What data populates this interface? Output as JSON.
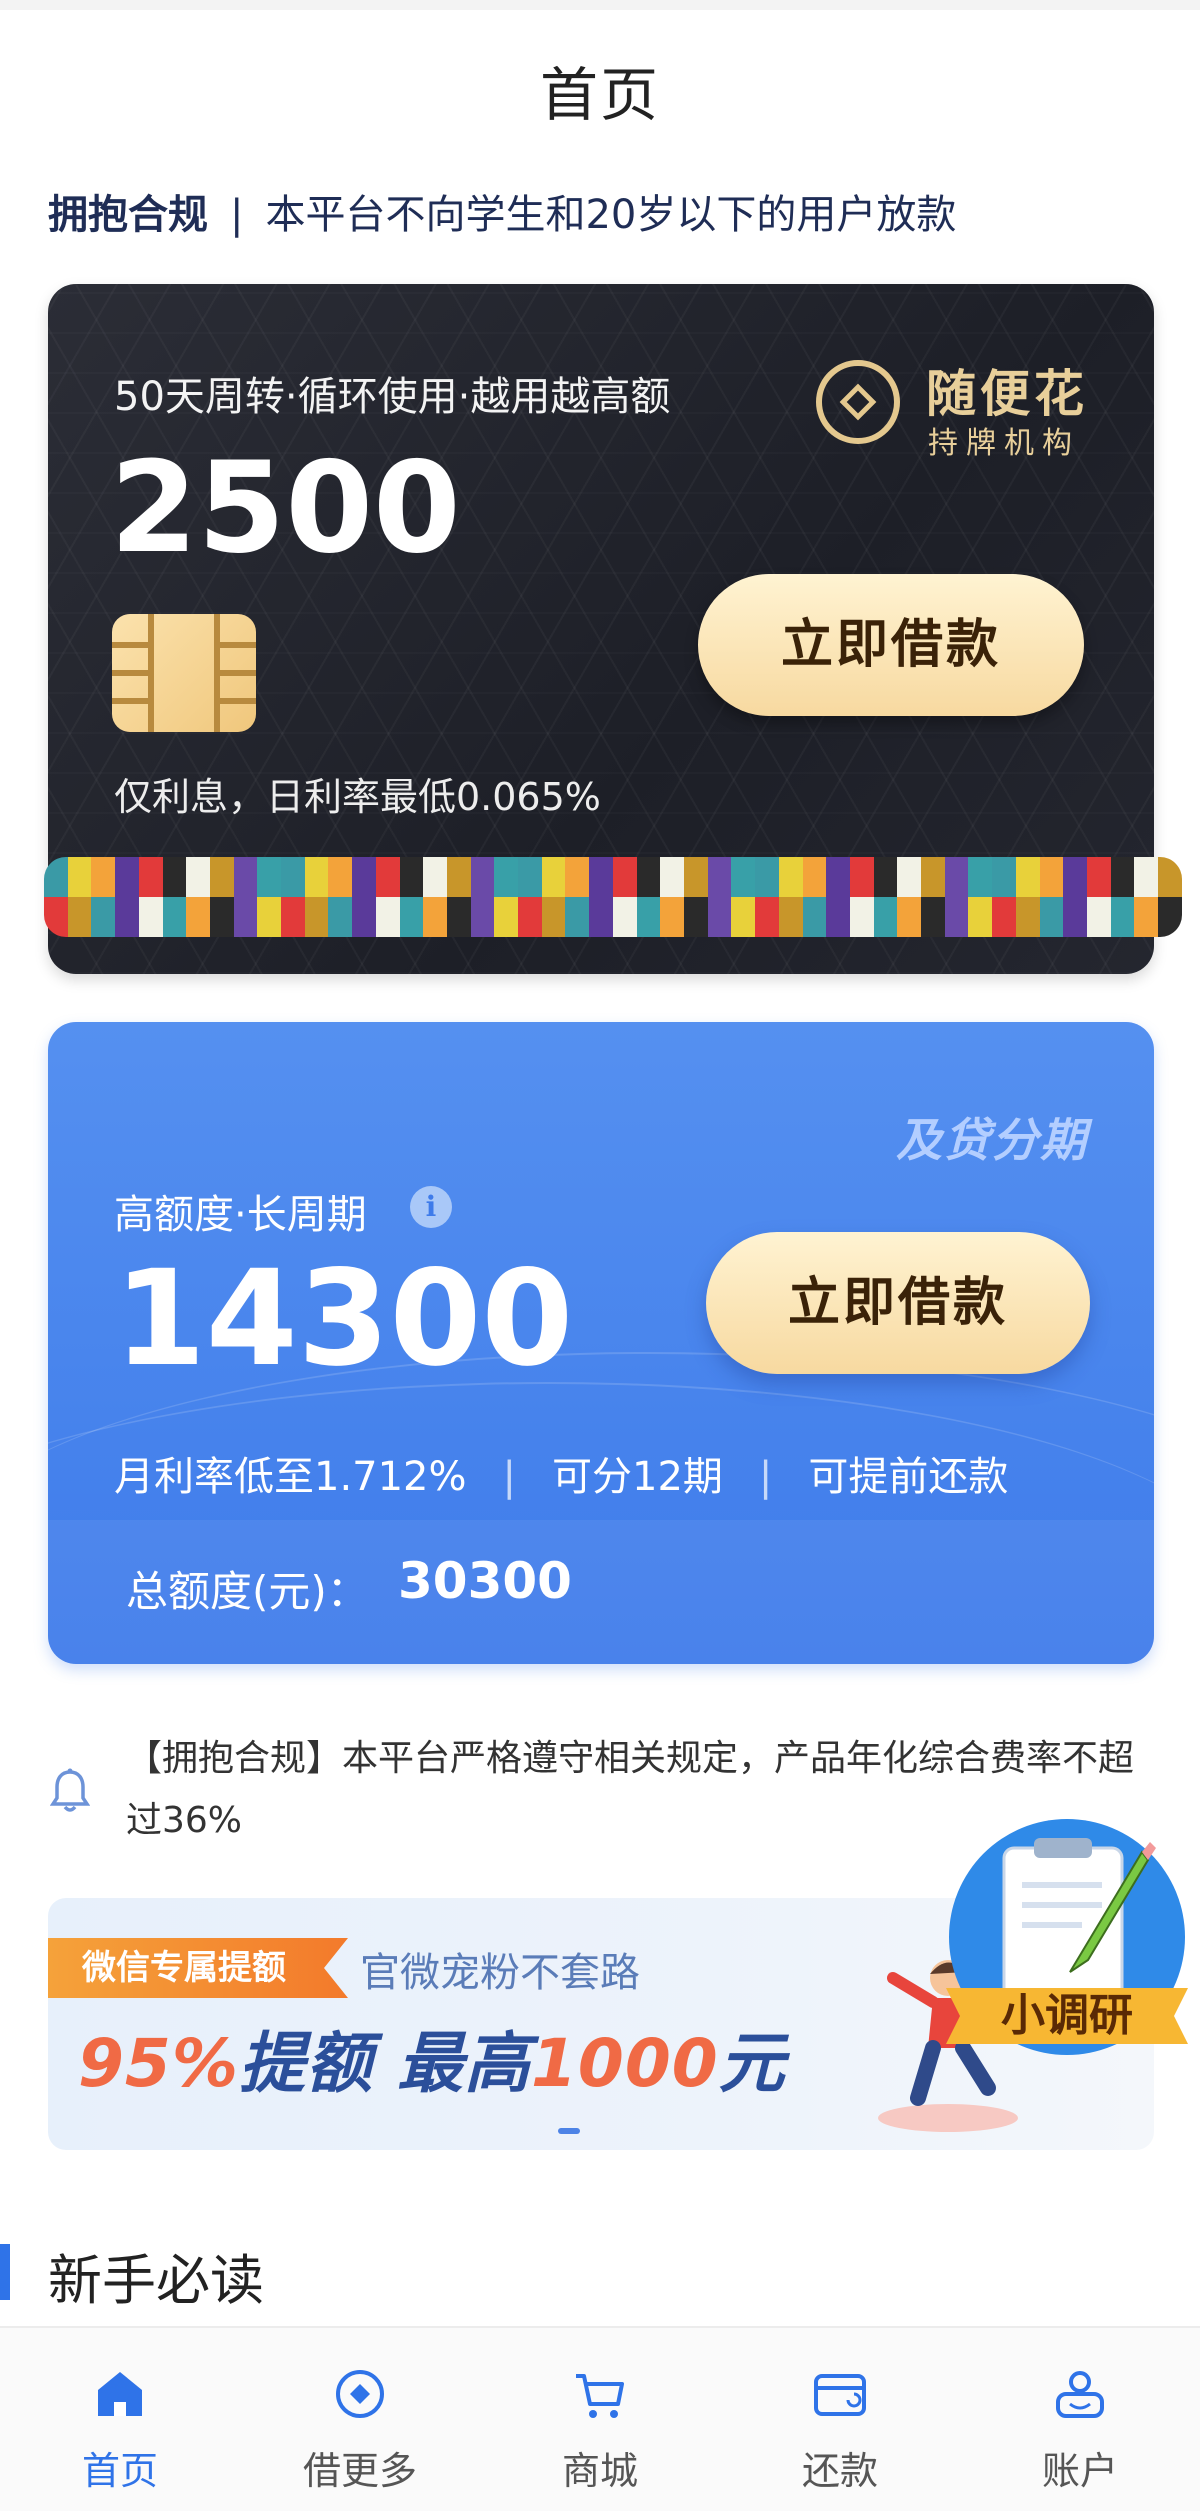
{
  "page": {
    "title": "首页"
  },
  "compliance": {
    "tag": "拥抱合规",
    "separator": "|",
    "text": "本平台不向学生和20岁以下的用户放款"
  },
  "card_primary": {
    "tagline": "50天周转·循环使用·越用越高额",
    "amount": "2500",
    "brand_name": "随便花",
    "brand_sub": "持牌机构",
    "button_label": "立即借款",
    "rate_text": "仅利息，日利率最低0.065%",
    "masked_strip": "redacted mosaic",
    "colors": {
      "background": "#23252e",
      "gold": "#e8cf9a",
      "button": "#f7d9a0"
    }
  },
  "card_secondary": {
    "brand": "及贷分期",
    "label": "高额度·长周期",
    "info_icon": "info-icon",
    "amount": "14300",
    "button_label": "立即借款",
    "features": [
      "月利率低至1.712%",
      "可分12期",
      "可提前还款"
    ],
    "feature_divider": "|",
    "total_label": "总额度(元)：",
    "total_value": "30300",
    "colors": {
      "background": "#4a86ee"
    }
  },
  "notice": {
    "icon": "bell-icon",
    "text": "【拥抱合规】本平台严格遵守相关规定，产品年化综合费率不超过36%"
  },
  "banner": {
    "tag": "微信专属提额",
    "subtitle": "官微宠粉不套路",
    "headline_part1": "95%",
    "headline_part2": "提额 最高",
    "headline_part3": "1000",
    "headline_part4": "元"
  },
  "survey": {
    "label": "小调研"
  },
  "section": {
    "title": "新手必读"
  },
  "tabbar": {
    "items": [
      {
        "label": "首页",
        "icon": "home-icon",
        "active": true
      },
      {
        "label": "借更多",
        "icon": "compass-icon",
        "active": false
      },
      {
        "label": "商城",
        "icon": "cart-icon",
        "active": false
      },
      {
        "label": "还款",
        "icon": "wallet-icon",
        "active": false
      },
      {
        "label": "账户",
        "icon": "user-icon",
        "active": false
      }
    ],
    "colors": {
      "active": "#2f73e8",
      "inactive": "#555555"
    }
  }
}
